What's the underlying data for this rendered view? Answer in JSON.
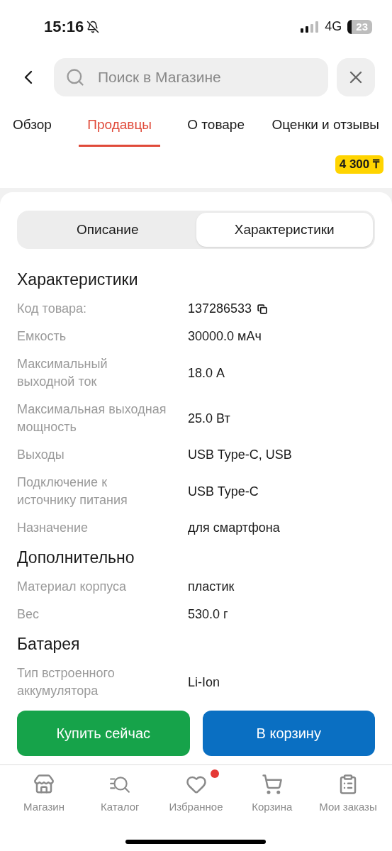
{
  "status_bar": {
    "time": "15:16",
    "network": "4G",
    "battery": "23"
  },
  "search": {
    "placeholder": "Поиск в Магазине"
  },
  "tabs": [
    {
      "label": "Обзор",
      "selected": false
    },
    {
      "label": "Продавцы",
      "selected": true
    },
    {
      "label": "О товаре",
      "selected": false
    },
    {
      "label": "Оценки и отзывы",
      "selected": false
    }
  ],
  "price_badge": "4 300 ₸",
  "segments": [
    {
      "label": "Описание",
      "selected": false
    },
    {
      "label": "Характеристики",
      "selected": true
    }
  ],
  "sections": [
    {
      "title": "Характеристики",
      "rows": [
        {
          "label": "Код товара:",
          "value": "137286533",
          "copy": true
        },
        {
          "label": "Емкость",
          "value": "30000.0 мАч",
          "copy": false
        },
        {
          "label": "Максимальный выходной ток",
          "value": "18.0 А",
          "copy": false
        },
        {
          "label": "Максимальная выходная мощность",
          "value": "25.0 Вт",
          "copy": false
        },
        {
          "label": "Выходы",
          "value": "USB Type-C, USB",
          "copy": false
        },
        {
          "label": "Подключение к источнику питания",
          "value": "USB Type-C",
          "copy": false
        },
        {
          "label": "Назначение",
          "value": "для смартфона",
          "copy": false
        }
      ]
    },
    {
      "title": "Дополнительно",
      "rows": [
        {
          "label": "Материал корпуса",
          "value": "пластик",
          "copy": false
        },
        {
          "label": "Вес",
          "value": "530.0 г",
          "copy": false
        }
      ]
    },
    {
      "title": "Батарея",
      "rows": [
        {
          "label": "Тип встроенного аккумулятора",
          "value": "Li-Ion",
          "copy": false
        }
      ]
    }
  ],
  "actions": [
    {
      "label": "Купить сейчас",
      "kind": "buy"
    },
    {
      "label": "В корзину",
      "kind": "cart"
    }
  ],
  "nav": [
    {
      "label": "Магазин",
      "kind": "store",
      "badge": false
    },
    {
      "label": "Каталог",
      "kind": "catalog",
      "badge": false
    },
    {
      "label": "Избранное",
      "kind": "heart",
      "badge": true
    },
    {
      "label": "Корзина",
      "kind": "cart",
      "badge": false
    },
    {
      "label": "Мои заказы",
      "kind": "orders",
      "badge": false
    }
  ]
}
